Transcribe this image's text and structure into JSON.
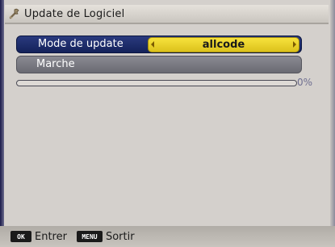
{
  "window": {
    "title": "Update de Logiciel",
    "icon": "wrench-icon"
  },
  "menu": {
    "items": [
      {
        "label": "Mode de update",
        "value": "allcode",
        "selected": true
      },
      {
        "label": "Marche"
      }
    ]
  },
  "progress": {
    "percent_text": "0%",
    "value": 0
  },
  "footer": {
    "ok_key": "OK",
    "ok_label": "Entrer",
    "menu_key": "MENU",
    "menu_label": "Sortir"
  },
  "colors": {
    "selected_row": "#1c2c6a",
    "value_box": "#ecd22a",
    "inactive_row": "#7a7a82",
    "background": "#d4d0cc"
  }
}
